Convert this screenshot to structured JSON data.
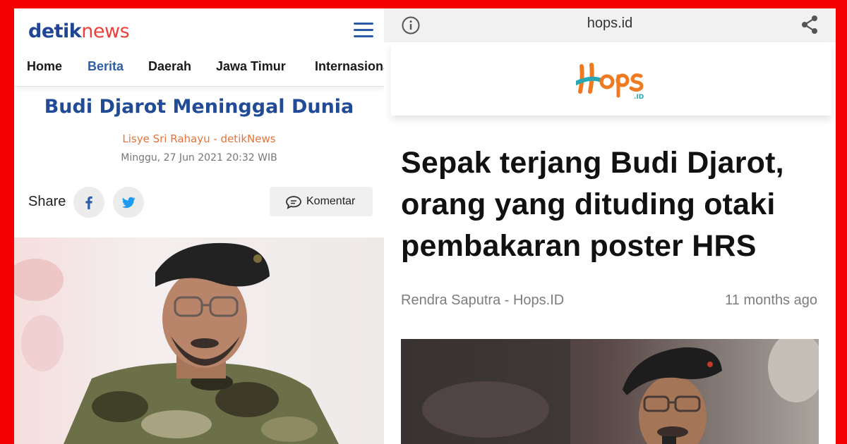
{
  "detik": {
    "logo_main": "detik",
    "logo_accent": "news",
    "nav": [
      "Home",
      "Berita",
      "Daerah",
      "Jawa Timur",
      "Internasional"
    ],
    "active_nav": "Berita",
    "title": "Budi Djarot Meninggal Dunia",
    "author": "Lisye Sri Rahayu - detikNews",
    "date": "Minggu, 27 Jun 2021 20:32 WIB",
    "share_label": "Share",
    "komentar_label": "Komentar"
  },
  "hops": {
    "url": "hops.id",
    "logo_text": "Hops",
    "logo_suffix": ".ID",
    "headline": "Sepak terjang Budi Djarot, orang yang dituding otaki pembakaran poster HRS",
    "byline": "Rendra Saputra - Hops.ID",
    "time_ago": "11 months ago"
  },
  "colors": {
    "frame": "#f50000",
    "detik_blue": "#1f4594",
    "detik_red": "#ee3f39",
    "author_orange": "#e8743b",
    "hops_teal": "#27a7b3",
    "hops_orange": "#f07a22"
  },
  "icons": [
    "menu-icon",
    "facebook-icon",
    "twitter-icon",
    "comment-icon",
    "info-icon",
    "share-icon"
  ]
}
